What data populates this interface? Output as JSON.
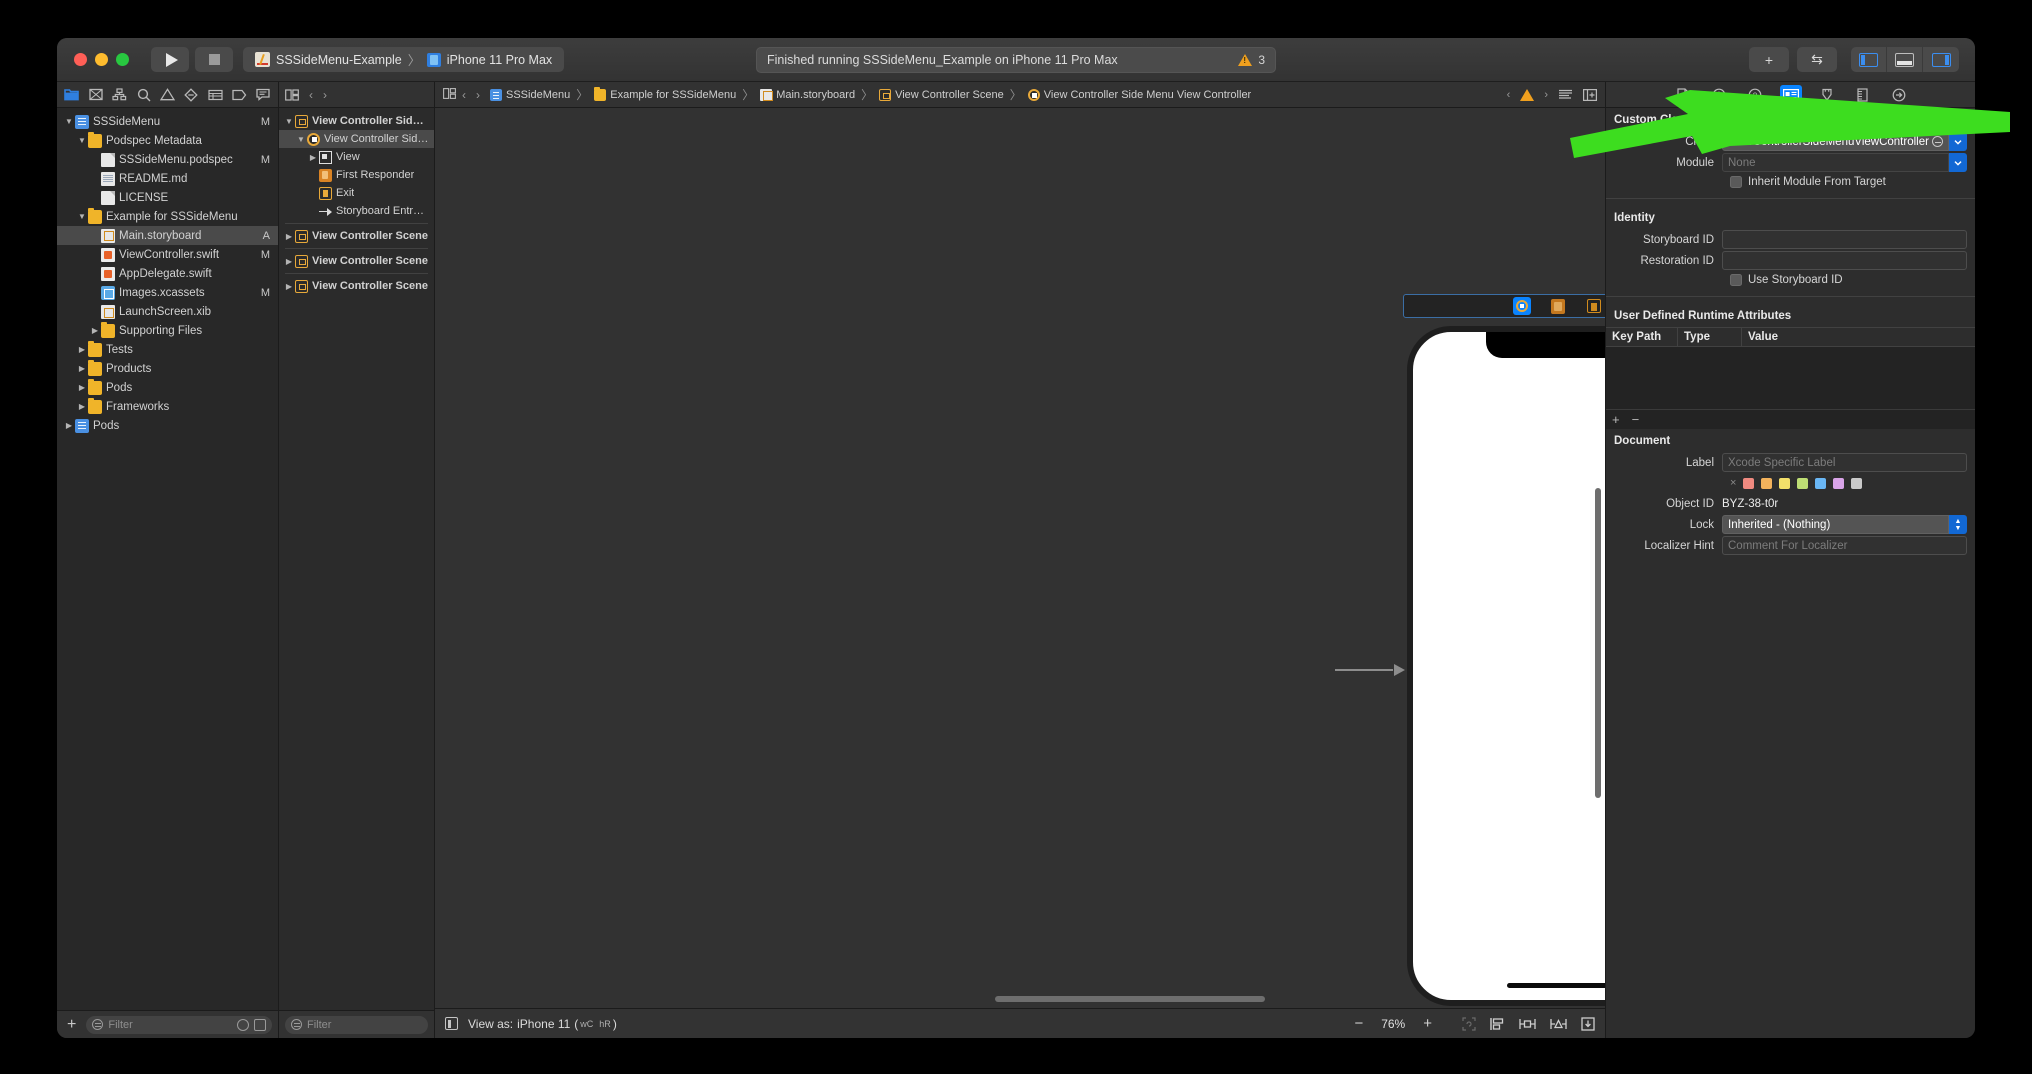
{
  "titlebar": {
    "run_label": "Run",
    "stop_label": "Stop",
    "scheme_name": "SSSideMenu-Example",
    "scheme_separator": "〉",
    "destination": "iPhone 11 Pro Max",
    "status_text": "Finished running SSSideMenu_Example on iPhone 11 Pro Max",
    "warning_count": "3",
    "add_label": "+",
    "editor_toggle_label": "⇆"
  },
  "navigator": {
    "tabs": [
      {
        "name": "project-navigator",
        "selected": true
      },
      {
        "name": "source-control-navigator",
        "selected": false
      },
      {
        "name": "symbol-navigator",
        "selected": false
      },
      {
        "name": "find-navigator",
        "selected": false
      },
      {
        "name": "issue-navigator",
        "selected": false
      },
      {
        "name": "test-navigator",
        "selected": false
      },
      {
        "name": "debug-navigator",
        "selected": false
      },
      {
        "name": "breakpoint-navigator",
        "selected": false
      },
      {
        "name": "report-navigator",
        "selected": false
      }
    ],
    "items": [
      {
        "label": "SSSideMenu",
        "indent": 0,
        "twisty": "▼",
        "icon": "project-icon",
        "status": "M",
        "selected": false
      },
      {
        "label": "Podspec Metadata",
        "indent": 1,
        "twisty": "▼",
        "icon": "folder-icon",
        "status": "",
        "selected": false
      },
      {
        "label": "SSSideMenu.podspec",
        "indent": 2,
        "twisty": "",
        "icon": "file-icon",
        "status": "M",
        "selected": false
      },
      {
        "label": "README.md",
        "indent": 2,
        "twisty": "",
        "icon": "markdown-icon",
        "status": "",
        "selected": false
      },
      {
        "label": "LICENSE",
        "indent": 2,
        "twisty": "",
        "icon": "file-icon",
        "status": "",
        "selected": false
      },
      {
        "label": "Example for SSSideMenu",
        "indent": 1,
        "twisty": "▼",
        "icon": "folder-icon",
        "status": "",
        "selected": false
      },
      {
        "label": "Main.storyboard",
        "indent": 2,
        "twisty": "",
        "icon": "storyboard-icon",
        "status": "A",
        "selected": true
      },
      {
        "label": "ViewController.swift",
        "indent": 2,
        "twisty": "",
        "icon": "swift-icon",
        "status": "M",
        "selected": false
      },
      {
        "label": "AppDelegate.swift",
        "indent": 2,
        "twisty": "",
        "icon": "swift-icon",
        "status": "",
        "selected": false
      },
      {
        "label": "Images.xcassets",
        "indent": 2,
        "twisty": "",
        "icon": "assets-icon",
        "status": "M",
        "selected": false
      },
      {
        "label": "LaunchScreen.xib",
        "indent": 2,
        "twisty": "",
        "icon": "xib-icon",
        "status": "",
        "selected": false
      },
      {
        "label": "Supporting Files",
        "indent": 2,
        "twisty": "▶",
        "icon": "folder-icon",
        "status": "",
        "selected": false
      },
      {
        "label": "Tests",
        "indent": 1,
        "twisty": "▶",
        "icon": "folder-icon",
        "status": "",
        "selected": false
      },
      {
        "label": "Products",
        "indent": 1,
        "twisty": "▶",
        "icon": "folder-icon",
        "status": "",
        "selected": false
      },
      {
        "label": "Pods",
        "indent": 1,
        "twisty": "▶",
        "icon": "folder-icon",
        "status": "",
        "selected": false
      },
      {
        "label": "Frameworks",
        "indent": 1,
        "twisty": "▶",
        "icon": "folder-icon",
        "status": "",
        "selected": false
      },
      {
        "label": "Pods",
        "indent": 0,
        "twisty": "▶",
        "icon": "project-icon",
        "status": "",
        "selected": false
      }
    ],
    "filter_placeholder": "Filter",
    "add_button_label": "+"
  },
  "outline": {
    "items": [
      {
        "label": "View Controller Side M…",
        "indent": 0,
        "twisty": "▼",
        "icon": "scene-icon",
        "bold": true,
        "selected": false
      },
      {
        "label": "View Controller Side…",
        "indent": 1,
        "twisty": "▼",
        "icon": "view-controller-icon",
        "bold": false,
        "selected": true
      },
      {
        "label": "View",
        "indent": 2,
        "twisty": "▶",
        "icon": "view-icon",
        "bold": false,
        "selected": false
      },
      {
        "label": "First Responder",
        "indent": 2,
        "twisty": "",
        "icon": "first-responder-icon",
        "bold": false,
        "selected": false
      },
      {
        "label": "Exit",
        "indent": 2,
        "twisty": "",
        "icon": "exit-icon",
        "bold": false,
        "selected": false
      },
      {
        "label": "Storyboard Entry Poi…",
        "indent": 2,
        "twisty": "",
        "icon": "entry-point-arrow-icon",
        "bold": false,
        "selected": false
      },
      {
        "divider": true
      },
      {
        "label": "View Controller Scene",
        "indent": 0,
        "twisty": "▶",
        "icon": "scene-icon",
        "bold": true,
        "selected": false
      },
      {
        "divider": true
      },
      {
        "label": "View Controller Scene",
        "indent": 0,
        "twisty": "▶",
        "icon": "scene-icon",
        "bold": true,
        "selected": false
      },
      {
        "divider": true
      },
      {
        "label": "View Controller Scene",
        "indent": 0,
        "twisty": "▶",
        "icon": "scene-icon",
        "bold": true,
        "selected": false
      }
    ],
    "filter_placeholder": "Filter"
  },
  "breadcrumb": {
    "back_label": "‹",
    "forward_label": "›",
    "items": [
      {
        "label": "SSSideMenu",
        "icon": "project-icon"
      },
      {
        "label": "Example for SSSideMenu",
        "icon": "folder-icon"
      },
      {
        "label": "Main.storyboard",
        "icon": "storyboard-icon"
      },
      {
        "label": "View Controller Scene",
        "icon": "scene-icon"
      },
      {
        "label": "View Controller Side Menu View Controller",
        "icon": "view-controller-icon"
      }
    ],
    "separator": "〉",
    "warning_prev": "‹",
    "warning_next": "›"
  },
  "canvas": {
    "scene_dock_items": [
      {
        "name": "view-controller-dock-icon",
        "selected": true
      },
      {
        "name": "first-responder-dock-icon",
        "selected": false
      },
      {
        "name": "exit-dock-icon",
        "selected": false
      }
    ],
    "view_as_label": "View as:",
    "device_name": "iPhone 11",
    "trait_open": "(",
    "trait_width": "wC",
    "trait_height": "hR",
    "trait_close": ")",
    "zoom_out_label": "−",
    "zoom_value": "76%",
    "zoom_in_label": "+"
  },
  "inspector": {
    "tabs": [
      {
        "name": "file-inspector-tab",
        "selected": false
      },
      {
        "name": "history-inspector-tab",
        "selected": false
      },
      {
        "name": "quick-help-inspector-tab",
        "selected": false
      },
      {
        "name": "identity-inspector-tab",
        "selected": true
      },
      {
        "name": "attributes-inspector-tab",
        "selected": false
      },
      {
        "name": "size-inspector-tab",
        "selected": false
      },
      {
        "name": "connections-inspector-tab",
        "selected": false
      }
    ],
    "custom_class": {
      "section_title": "Custom Class",
      "class_label": "Class",
      "class_value": "ViewControllerSideMenuViewController",
      "module_label": "Module",
      "module_placeholder": "None",
      "inherit_label": "Inherit Module From Target"
    },
    "identity": {
      "section_title": "Identity",
      "storyboard_id_label": "Storyboard ID",
      "storyboard_id_value": "",
      "restoration_id_label": "Restoration ID",
      "restoration_id_value": "",
      "use_storyboard_id_label": "Use Storyboard ID"
    },
    "runtime_attributes": {
      "section_title": "User Defined Runtime Attributes",
      "columns": [
        "Key Path",
        "Type",
        "Value"
      ],
      "rows": [],
      "add_label": "+",
      "remove_label": "−"
    },
    "document": {
      "section_title": "Document",
      "label_label": "Label",
      "label_placeholder": "Xcode Specific Label",
      "swatch_clear": "×",
      "swatches": [
        "#f08a80",
        "#f2b25c",
        "#f3e06a",
        "#bede74",
        "#6ab7f5",
        "#d9a4e8",
        "#c9c9c9"
      ],
      "object_id_label": "Object ID",
      "object_id_value": "BYZ-38-t0r",
      "lock_label": "Lock",
      "lock_value": "Inherited - (Nothing)",
      "localizer_hint_label": "Localizer Hint",
      "localizer_hint_placeholder": "Comment For Localizer"
    }
  },
  "annotation": {
    "arrow_color": "#3ddd1f",
    "name": "green-pointer-arrow"
  }
}
